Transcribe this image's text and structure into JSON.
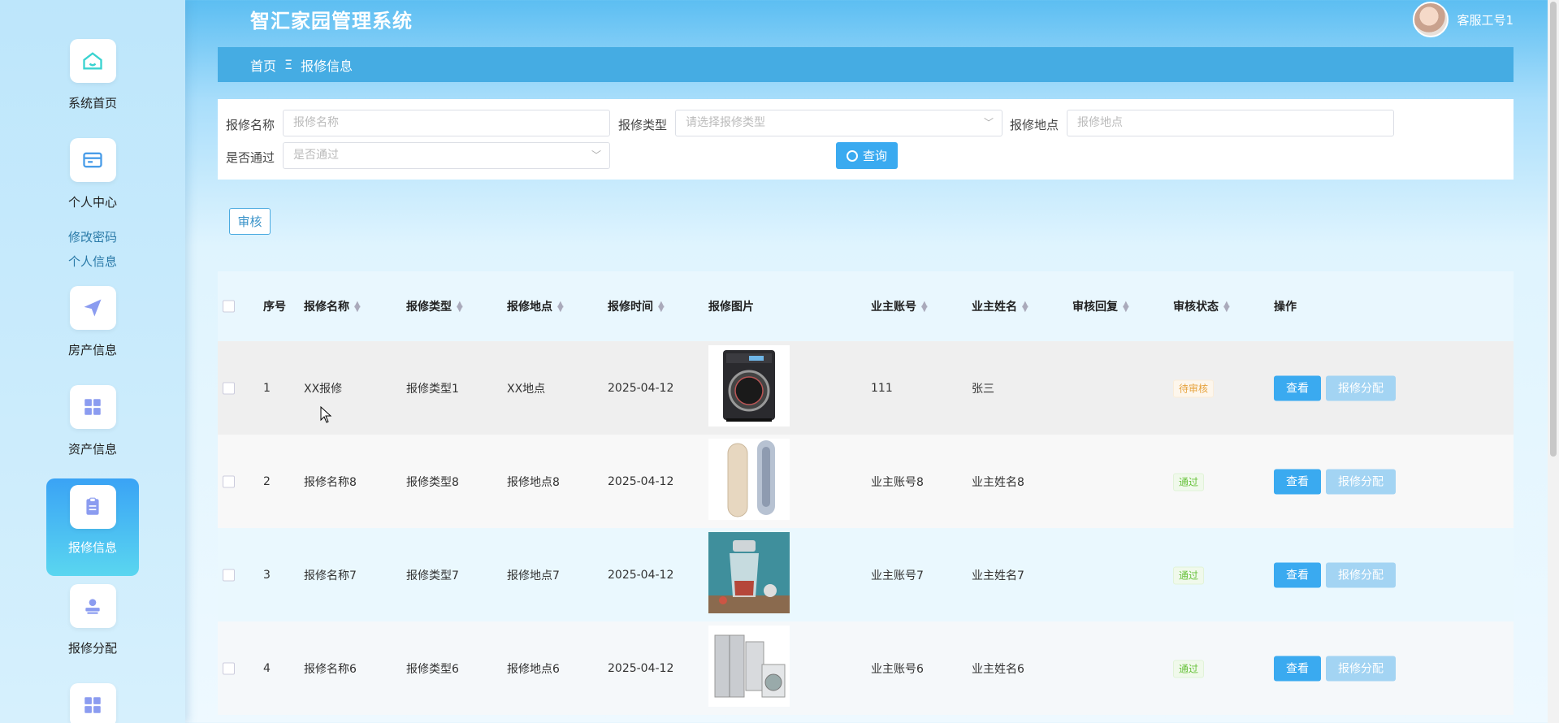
{
  "app": {
    "title": "智汇家园管理系统",
    "user": "客服工号1"
  },
  "sidebar": {
    "items": [
      {
        "label": "系统首页",
        "icon": "home-icon"
      },
      {
        "label": "个人中心",
        "icon": "wallet-icon"
      },
      {
        "label": "房产信息",
        "icon": "send-icon"
      },
      {
        "label": "资产信息",
        "icon": "grid-icon"
      },
      {
        "label": "报修信息",
        "icon": "document-icon"
      },
      {
        "label": "报修分配",
        "icon": "user-icon"
      },
      {
        "label": "",
        "icon": "grid-icon"
      }
    ],
    "sub_links": [
      "修改密码",
      "个人信息"
    ]
  },
  "breadcrumb": {
    "home": "首页",
    "separator": "Ξ",
    "current": "报修信息"
  },
  "search": {
    "name_label": "报修名称",
    "name_placeholder": "报修名称",
    "type_label": "报修类型",
    "type_placeholder": "请选择报修类型",
    "location_label": "报修地点",
    "location_placeholder": "报修地点",
    "pass_label": "是否通过",
    "pass_placeholder": "是否通过",
    "query_button": "查询"
  },
  "actions": {
    "audit_button": "审核"
  },
  "table": {
    "columns": [
      "序号",
      "报修名称",
      "报修类型",
      "报修地点",
      "报修时间",
      "报修图片",
      "业主账号",
      "业主姓名",
      "审核回复",
      "审核状态",
      "操作"
    ],
    "rows": [
      {
        "index": "1",
        "name": "XX报修",
        "type": "报修类型1",
        "location": "XX地点",
        "time": "2025-04-12",
        "image": "washing-machine",
        "account": "111",
        "owner": "张三",
        "reply": "",
        "status": "待审核",
        "status_kind": "pending"
      },
      {
        "index": "2",
        "name": "报修名称8",
        "type": "报修类型8",
        "location": "报修地点8",
        "time": "2025-04-12",
        "image": "air-conditioner",
        "account": "业主账号8",
        "owner": "业主姓名8",
        "reply": "",
        "status": "通过",
        "status_kind": "pass"
      },
      {
        "index": "3",
        "name": "报修名称7",
        "type": "报修类型7",
        "location": "报修地点7",
        "time": "2025-04-12",
        "image": "food-processor",
        "account": "业主账号7",
        "owner": "业主姓名7",
        "reply": "",
        "status": "通过",
        "status_kind": "pass"
      },
      {
        "index": "4",
        "name": "报修名称6",
        "type": "报修类型6",
        "location": "报修地点6",
        "time": "2025-04-12",
        "image": "appliances",
        "account": "业主账号6",
        "owner": "业主姓名6",
        "reply": "",
        "status": "通过",
        "status_kind": "pass"
      }
    ],
    "view_button": "查看",
    "assign_button": "报修分配"
  },
  "colors": {
    "accent": "#3aaaf0",
    "breadcrumb": "#45ace3",
    "pending": "#e6a23c",
    "pass": "#67c23a"
  }
}
